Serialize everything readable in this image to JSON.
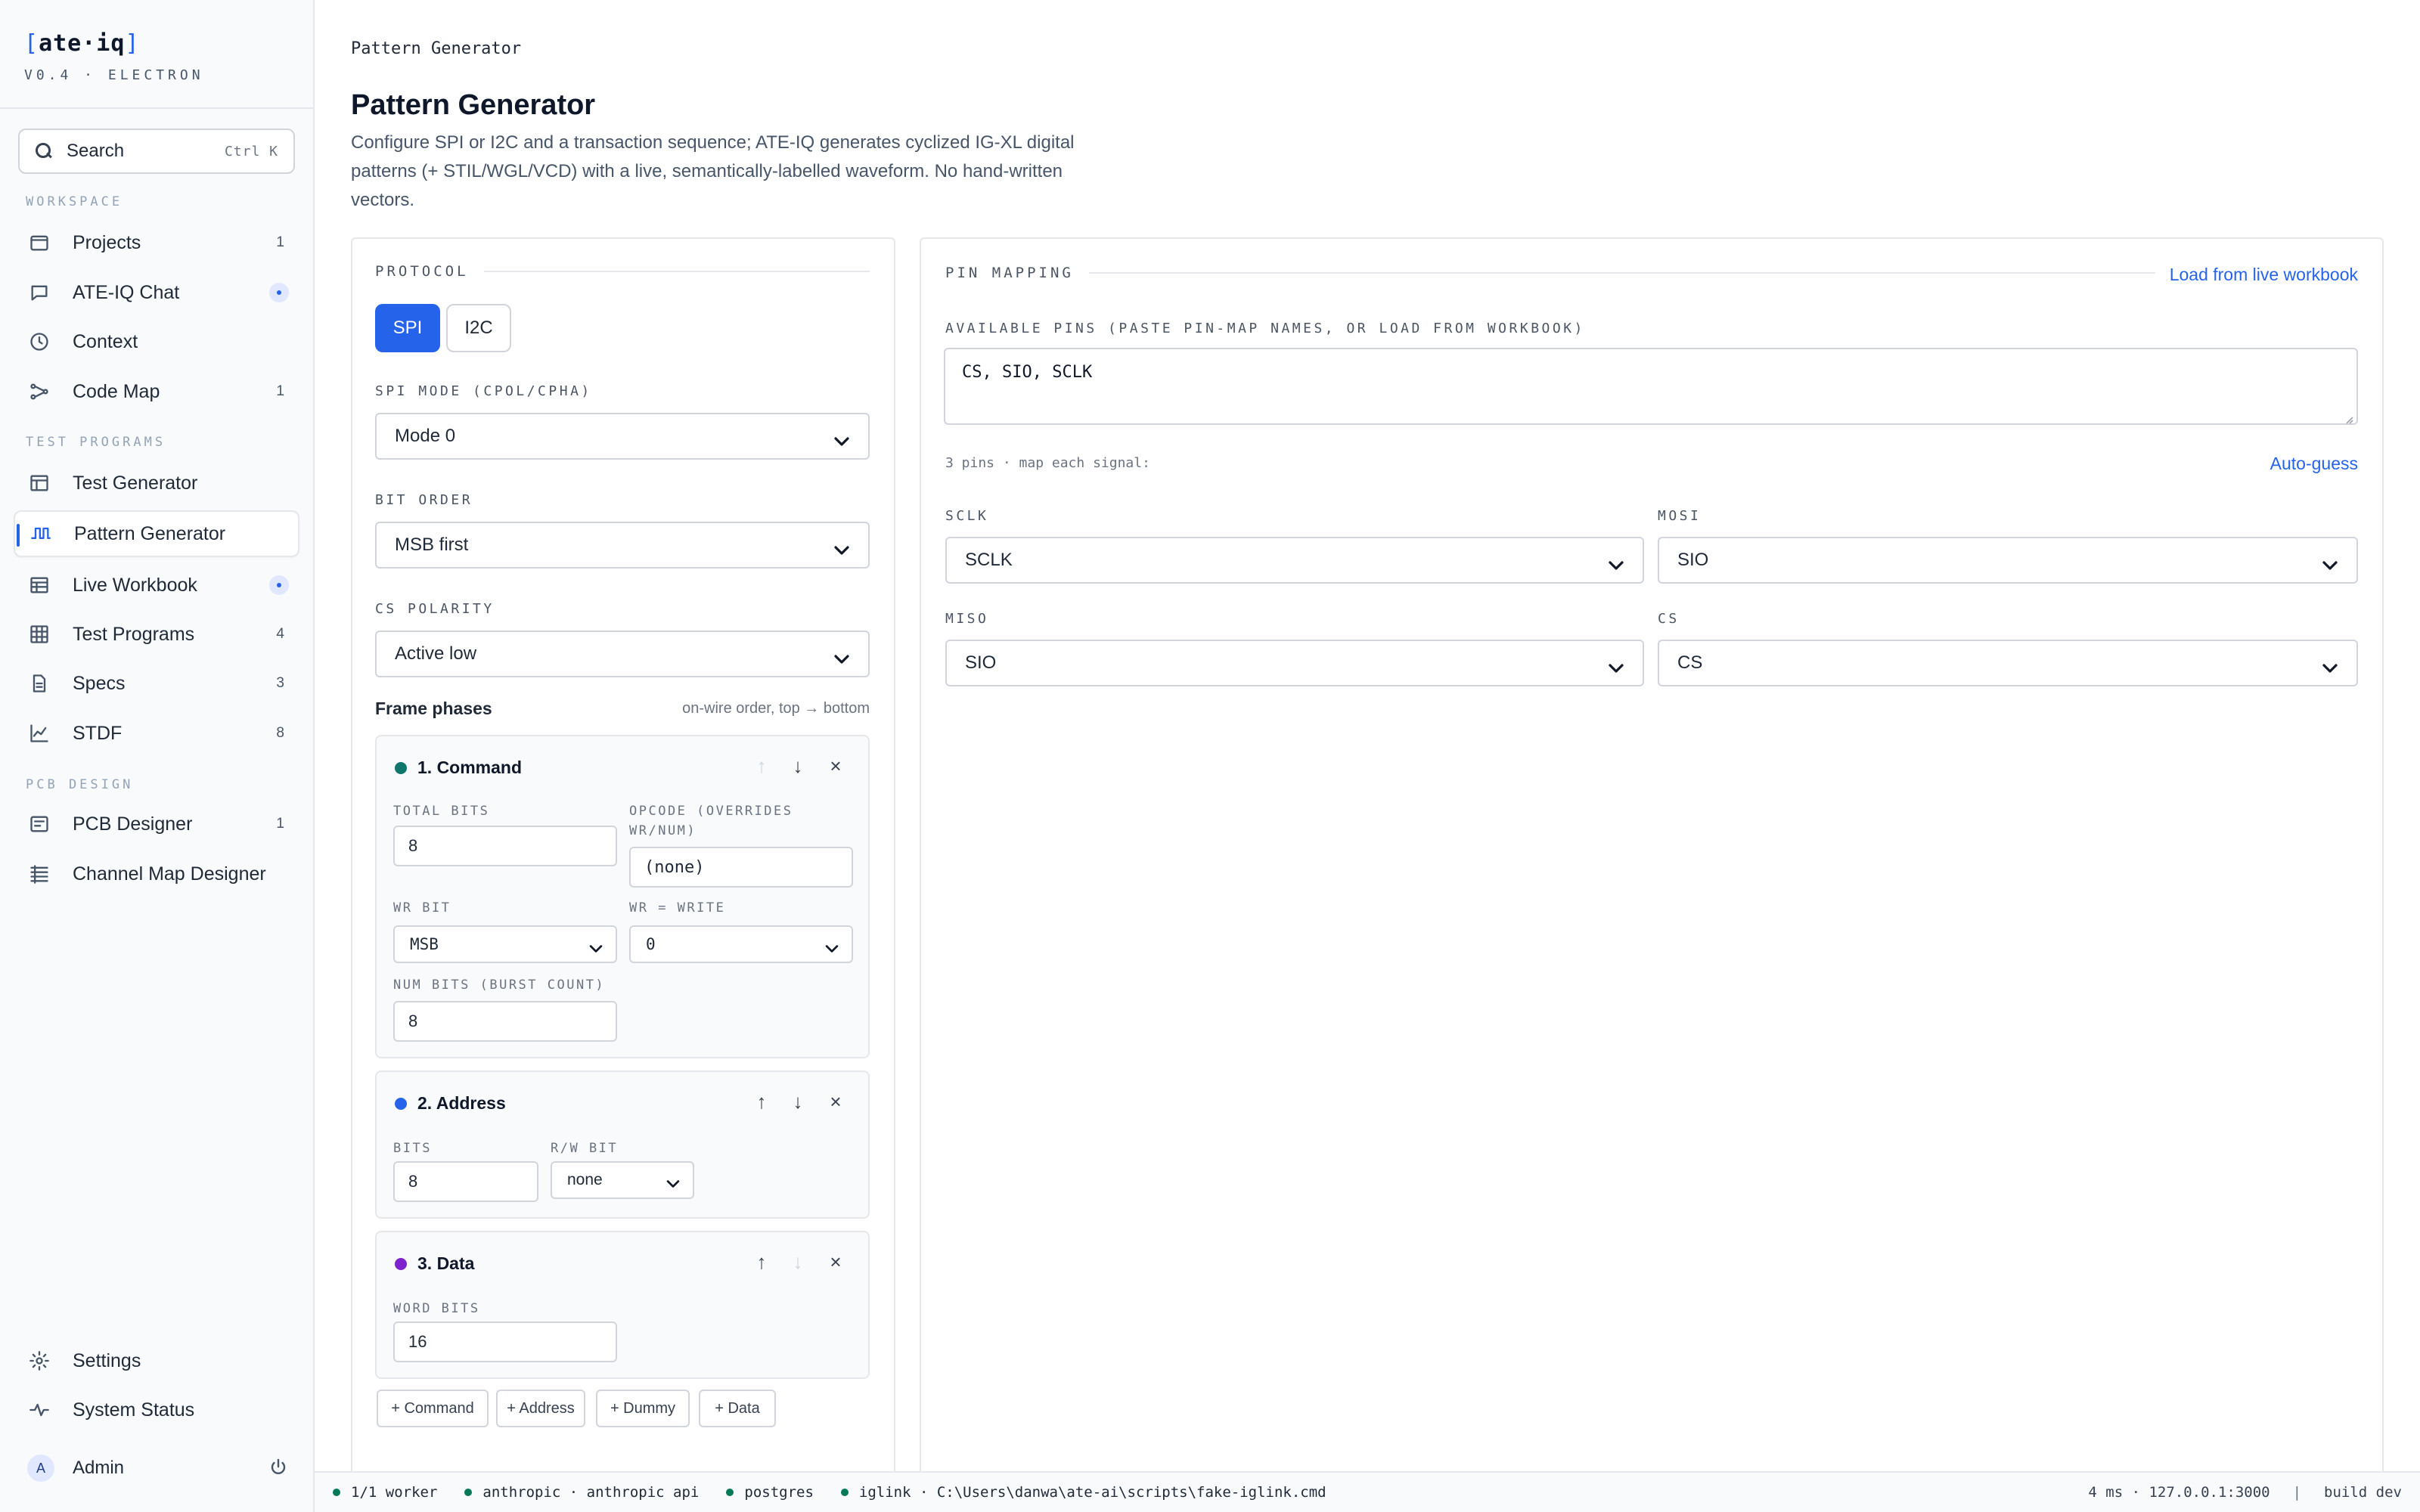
{
  "brand": {
    "name": "ate·iq",
    "version": "V0.4 · ELECTRON"
  },
  "search": {
    "label": "Search",
    "shortcut": "Ctrl K"
  },
  "sidebar": {
    "sections": [
      "WORKSPACE",
      "TEST PROGRAMS",
      "PCB DESIGN"
    ],
    "items": [
      {
        "label": "Projects",
        "badge": "1"
      },
      {
        "label": "ATE-IQ Chat",
        "badge": ""
      },
      {
        "label": "Context",
        "badge": ""
      },
      {
        "label": "Code Map",
        "badge": "1"
      },
      {
        "label": "Test Generator",
        "badge": ""
      },
      {
        "label": "Pattern Generator",
        "badge": ""
      },
      {
        "label": "Live Workbook",
        "badge": ""
      },
      {
        "label": "Test Programs",
        "badge": "4"
      },
      {
        "label": "Specs",
        "badge": "3"
      },
      {
        "label": "STDF",
        "badge": "8"
      },
      {
        "label": "PCB Designer",
        "badge": "1"
      },
      {
        "label": "Channel Map Designer",
        "badge": ""
      }
    ],
    "settings": "Settings",
    "system_status": "System Status",
    "user": {
      "initial": "A",
      "name": "Admin"
    }
  },
  "main": {
    "breadcrumb": "Pattern Generator",
    "title": "Pattern Generator",
    "description": "Configure SPI or I2C and a transaction sequence; ATE-IQ generates cyclized IG-XL digital patterns (+ STIL/WGL/VCD) with a live, semantically-labelled waveform. No hand-written vectors."
  },
  "protocol": {
    "header": "PROTOCOL",
    "options": [
      "SPI",
      "I2C"
    ],
    "spi_mode_label": "SPI MODE (CPOL/CPHA)",
    "spi_mode_value": "Mode 0",
    "bit_order_label": "BIT ORDER",
    "bit_order_value": "MSB first",
    "cs_polarity_label": "CS POLARITY",
    "cs_polarity_value": "Active low",
    "frame_phases_label": "Frame phases",
    "frame_phases_hint": "on-wire order, top → bottom"
  },
  "phases": {
    "command": {
      "title": "1. Command",
      "total_bits_label": "TOTAL BITS",
      "total_bits": "8",
      "opcode_label": "OPCODE (OVERRIDES WR/NUM)",
      "opcode": "(none)",
      "wr_bit_label": "WR BIT",
      "wr_bit": "MSB",
      "wr_write_label": "WR = WRITE",
      "wr_write": "0",
      "num_bits_label": "NUM BITS (BURST COUNT)",
      "num_bits": "8"
    },
    "address": {
      "title": "2. Address",
      "bits_label": "BITS",
      "bits": "8",
      "rw_label": "R/W BIT",
      "rw": "none"
    },
    "data": {
      "title": "3. Data",
      "word_bits_label": "WORD BITS",
      "word_bits": "16"
    },
    "add_buttons": [
      "+ Command",
      "+ Address",
      "+ Dummy",
      "+ Data"
    ],
    "colors": {
      "command": "#0f766e",
      "address": "#2563eb",
      "data": "#7e22ce"
    }
  },
  "pin_mapping": {
    "header": "PIN MAPPING",
    "load_link": "Load from live workbook",
    "available_label": "AVAILABLE PINS (PASTE PIN-MAP NAMES, OR LOAD FROM WORKBOOK)",
    "available_value": "CS, SIO, SCLK",
    "count_text": "3 pins · map each signal:",
    "auto_guess": "Auto-guess",
    "signals": [
      {
        "label": "SCLK",
        "value": "SCLK"
      },
      {
        "label": "MOSI",
        "value": "SIO"
      },
      {
        "label": "MISO",
        "value": "SIO"
      },
      {
        "label": "CS",
        "value": "CS"
      }
    ]
  },
  "statusbar": {
    "workers": "1/1 worker",
    "anthropic": "anthropic · anthropic api",
    "postgres": "postgres",
    "iglink": "iglink · C:\\Users\\danwa\\ate-ai\\scripts\\fake-iglink.cmd",
    "latency": "4 ms · 127.0.0.1:3000",
    "sep": "|",
    "build": "build dev"
  },
  "colors": {
    "accent": "#2563eb",
    "status_ok": "#047857"
  }
}
